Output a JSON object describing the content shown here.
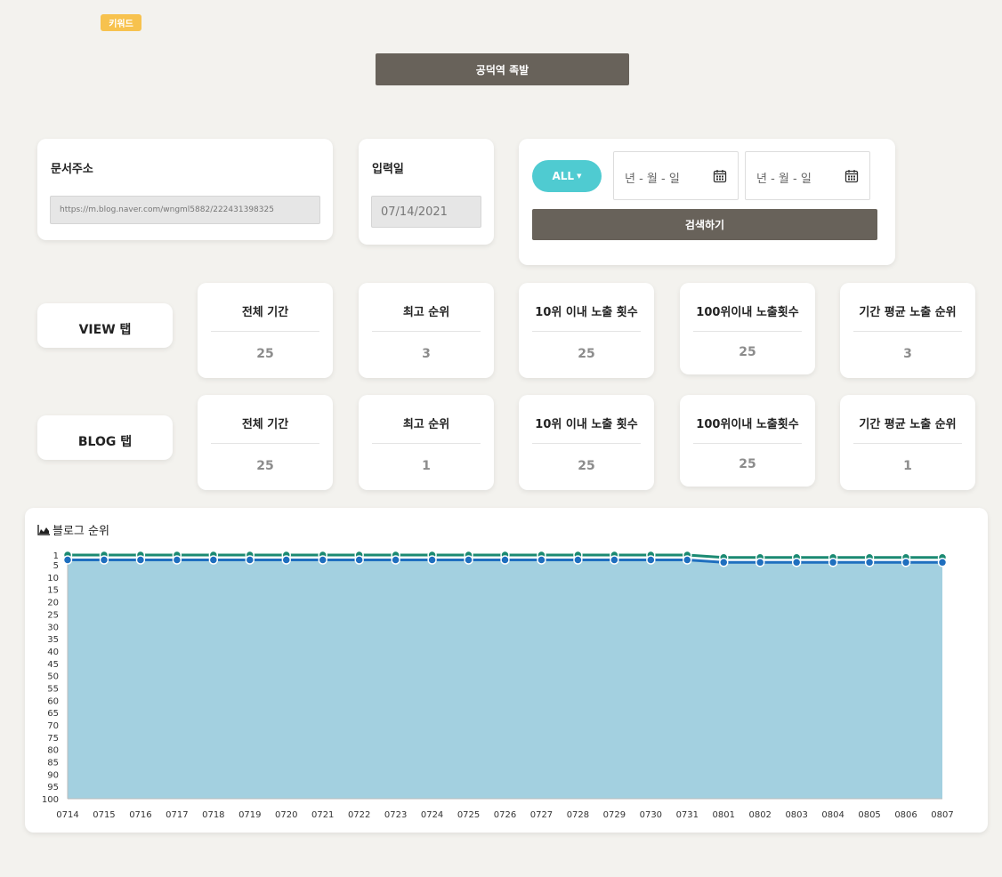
{
  "header": {
    "keyword_badge": "키워드",
    "keyword_title": "공덕역 족발"
  },
  "doc_url": {
    "label": "문서주소",
    "value": "https://m.blog.naver.com/wngml5882/222431398325"
  },
  "input_date": {
    "label": "입력일",
    "value": "07/14/2021"
  },
  "search": {
    "filter_label": "ALL",
    "start_date_placeholder": "년 - 월 - 일",
    "end_date_placeholder": "년 - 월 - 일",
    "search_button": "검색하기"
  },
  "view_tab": {
    "label": "VIEW 탭",
    "stats": [
      {
        "title": "전체 기간",
        "value": "25"
      },
      {
        "title": "최고 순위",
        "value": "3"
      },
      {
        "title": "10위 이내 노출 횟수",
        "value": "25"
      },
      {
        "title": "100위이내 노출횟수",
        "value": "25"
      },
      {
        "title": "기간 평균 노출 순위",
        "value": "3"
      }
    ]
  },
  "blog_tab": {
    "label": "BLOG 탭",
    "stats": [
      {
        "title": "전체 기간",
        "value": "25"
      },
      {
        "title": "최고 순위",
        "value": "1"
      },
      {
        "title": "10위 이내 노출 횟수",
        "value": "25"
      },
      {
        "title": "100위이내 노출횟수",
        "value": "25"
      },
      {
        "title": "기간 평균 노출 순위",
        "value": "1"
      }
    ]
  },
  "chart_title": "블로그 순위",
  "colors": {
    "accent": "#4fcbd1",
    "button_dark": "#68625a",
    "badge": "#f7c24e",
    "series_green": "#1b8a72",
    "series_blue": "#1f6fbf",
    "area_fill": "#a3d0e0"
  },
  "chart_data": {
    "type": "line",
    "title": "블로그 순위",
    "categories": [
      "0714",
      "0715",
      "0716",
      "0717",
      "0718",
      "0719",
      "0720",
      "0721",
      "0722",
      "0723",
      "0724",
      "0725",
      "0726",
      "0727",
      "0728",
      "0729",
      "0730",
      "0731",
      "0801",
      "0802",
      "0803",
      "0804",
      "0805",
      "0806",
      "0807"
    ],
    "series": [
      {
        "values": [
          1,
          1,
          1,
          1,
          1,
          1,
          1,
          1,
          1,
          1,
          1,
          1,
          1,
          1,
          1,
          1,
          1,
          1,
          2,
          2,
          2,
          2,
          2,
          2,
          2
        ]
      },
      {
        "values": [
          3,
          3,
          3,
          3,
          3,
          3,
          3,
          3,
          3,
          3,
          3,
          3,
          3,
          3,
          3,
          3,
          3,
          3,
          4,
          4,
          4,
          4,
          4,
          4,
          4
        ]
      }
    ],
    "y_ticks": [
      1,
      5,
      10,
      15,
      20,
      25,
      30,
      35,
      40,
      45,
      50,
      55,
      60,
      65,
      70,
      75,
      80,
      85,
      90,
      95,
      100
    ],
    "ylim": [
      1,
      100
    ],
    "y_reversed": true,
    "area_under": true
  }
}
